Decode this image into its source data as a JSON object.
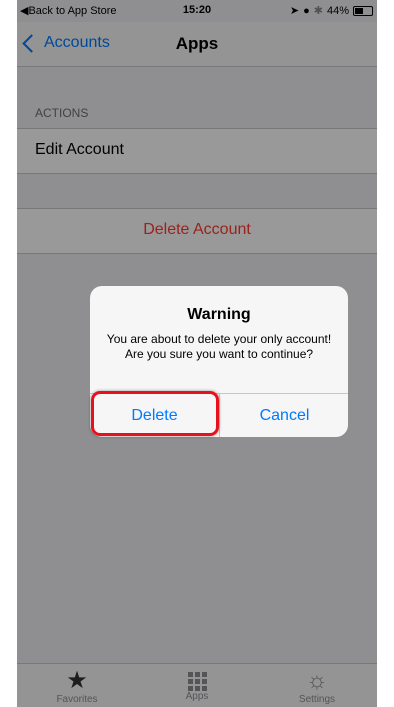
{
  "status_bar": {
    "back_label": "◀Back to App Store",
    "time": "15:20",
    "battery": "44%"
  },
  "nav": {
    "back_label": "Accounts",
    "title": "Apps"
  },
  "sections": {
    "actions_header": "ACTIONS",
    "edit_account": "Edit Account",
    "delete_account": "Delete Account"
  },
  "tab_bar": {
    "favorites": "Favorites",
    "apps": "Apps",
    "settings": "Settings"
  },
  "alert": {
    "title": "Warning",
    "message": "You are about to delete your only account! Are you sure you want to continue?",
    "delete_label": "Delete",
    "cancel_label": "Cancel"
  },
  "colors": {
    "accent": "#007aff",
    "destructive": "#ff3b30",
    "highlight": "#e8101a"
  }
}
